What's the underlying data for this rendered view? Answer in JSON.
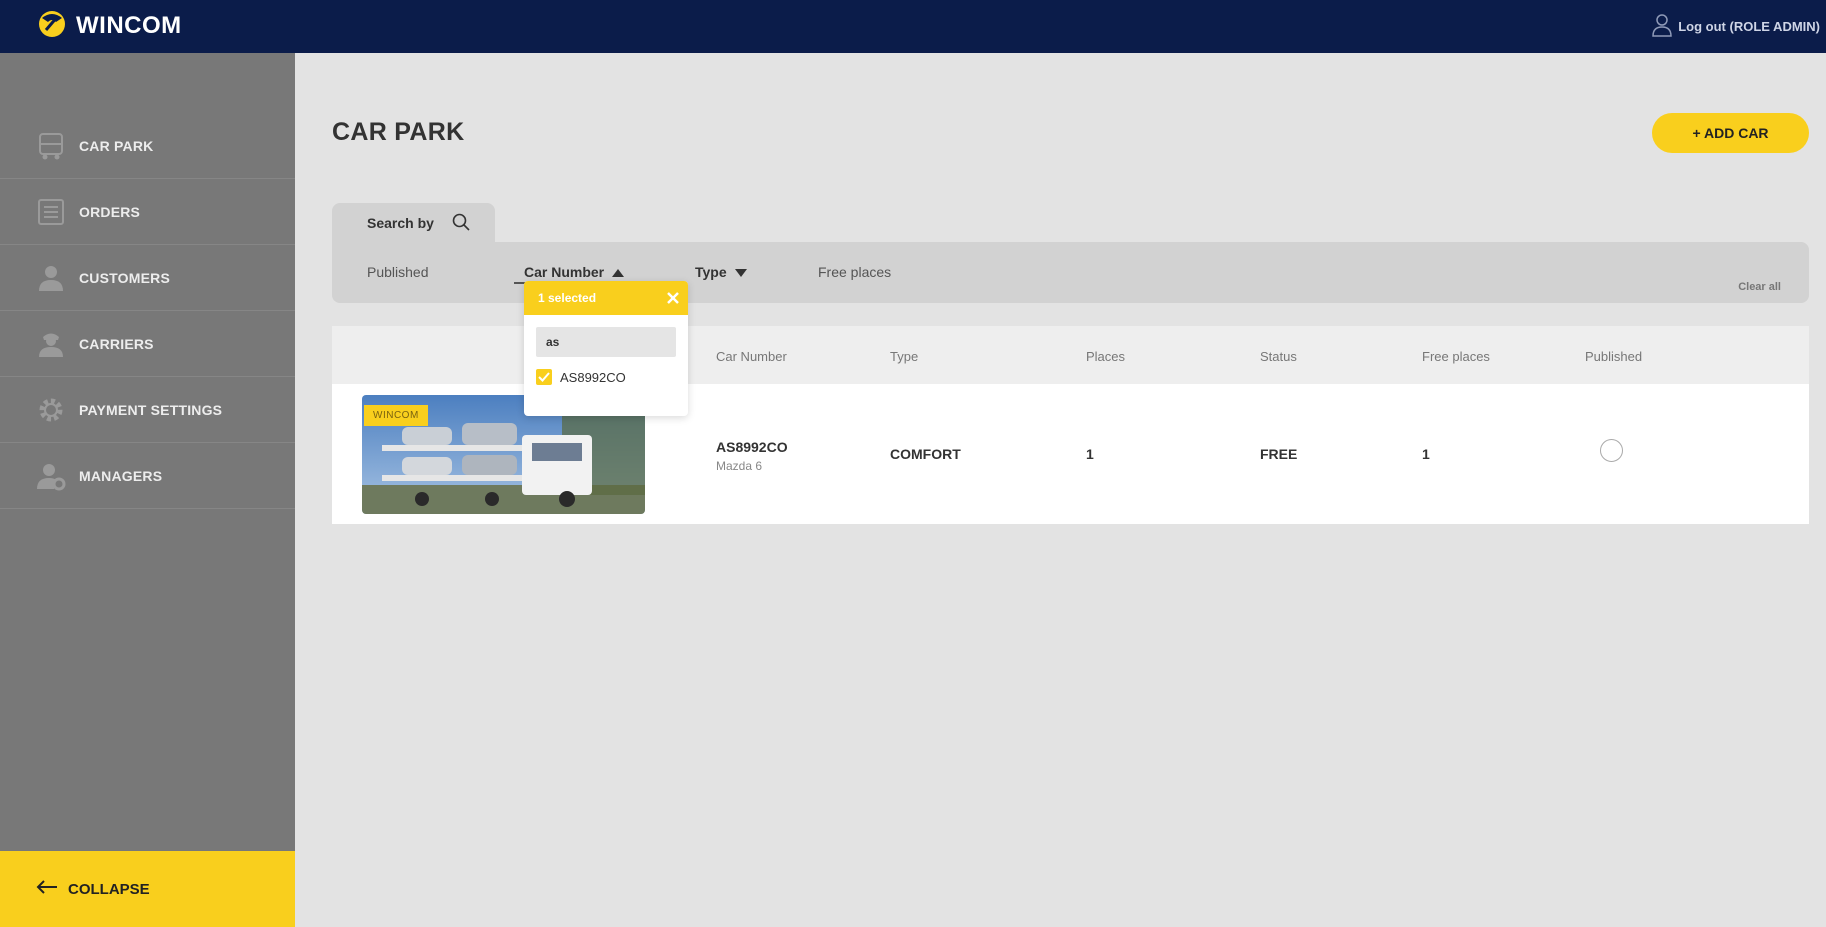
{
  "header": {
    "brand": "WINCOM",
    "logout_label": "Log out (ROLE ADMIN)"
  },
  "sidebar": {
    "items": [
      {
        "label": "CAR PARK",
        "icon": "truck-icon"
      },
      {
        "label": "ORDERS",
        "icon": "orders-icon"
      },
      {
        "label": "CUSTOMERS",
        "icon": "customer-icon"
      },
      {
        "label": "CARRIERS",
        "icon": "carrier-icon"
      },
      {
        "label": "PAYMENT SETTINGS",
        "icon": "gear-icon"
      },
      {
        "label": "MANAGERS",
        "icon": "manager-icon"
      }
    ],
    "collapse_label": "COLLAPSE"
  },
  "main": {
    "title": "CAR PARK",
    "add_button": "+ ADD CAR",
    "search_tab": "Search by",
    "filters": {
      "published": "Published",
      "car_number": "Car Number",
      "type": "Type",
      "free_places": "Free places",
      "clear_all": "Clear all"
    },
    "dropdown": {
      "selected_text": "1 selected",
      "search_value": "as",
      "options": [
        {
          "label": "AS8992CO",
          "checked": true
        }
      ]
    },
    "table": {
      "columns": [
        "Car Number",
        "Type",
        "Places",
        "Status",
        "Free places",
        "Published"
      ],
      "rows": [
        {
          "badge": "WINCOM",
          "car_number": "AS8992CO",
          "model": "Mazda 6",
          "type": "COMFORT",
          "places": "1",
          "status": "FREE",
          "free_places": "1",
          "published": false
        }
      ]
    }
  },
  "colors": {
    "accent": "#f9cf1d",
    "header_bg": "#0b1c4a",
    "sidebar_bg": "#787878",
    "page_bg": "#e3e3e3"
  }
}
